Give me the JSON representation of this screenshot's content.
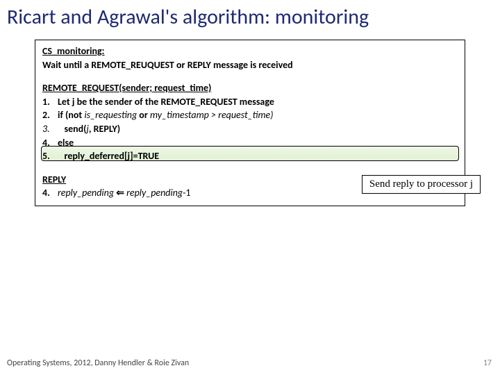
{
  "title": "Ricart and Agrawal's algorithm: monitoring",
  "algo": {
    "section1": {
      "label": "CS_monitoring:",
      "wait_line": "Wait until a REMOTE_REUQUEST or REPLY message is received"
    },
    "section2": {
      "label": "REMOTE_REQUEST(sender; request_time)",
      "lines": {
        "n1": "1.",
        "l1": "Let j be the sender of the REMOTE_REQUEST message",
        "n2": "2.",
        "l2_pre": "if (not ",
        "l2_i1": "is_requesting",
        "l2_mid": " or ",
        "l2_i2": "my_timestamp > request_time)",
        "n3": "3.",
        "l3_pre": "send(",
        "l3_j": "j",
        "l3_post": ", REPLY)",
        "n4": "4.",
        "l4": "else",
        "n5": "5.",
        "l5": "reply_deferred[j]=TRUE"
      }
    },
    "section3": {
      "label": "REPLY",
      "n4": "4.",
      "l4_i1": "reply_pending",
      "l4_arrow": " ⇐ ",
      "l4_i2": "reply_pending",
      "l4_tail": "-1"
    }
  },
  "callout": "Send reply to processor j",
  "footer": {
    "left": "Operating Systems, 2012, Danny Hendler & Roie Zivan",
    "pagenum": "17"
  }
}
